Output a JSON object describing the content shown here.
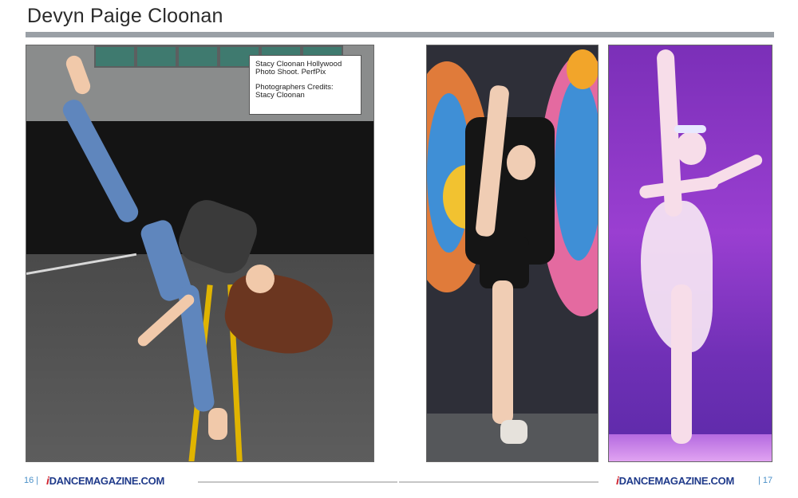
{
  "page": {
    "title": "Devyn Paige Cloonan"
  },
  "caption": {
    "line1": "Stacy Cloonan  Hollywood",
    "line2": "Photo Shoot.  PerfPix",
    "line3": "Photographers Credits:",
    "line4": "Stacy Cloonan"
  },
  "footer": {
    "left_page": "16 |",
    "right_page": "| 17",
    "brand_i": "i",
    "brand_name": "DANCEMAGAZINE.COM"
  },
  "photos": [
    {
      "subject": "street dance photo"
    },
    {
      "subject": "mural split photo"
    },
    {
      "subject": "stage ballet photo"
    }
  ],
  "colors": {
    "accent_rule": "#9aa0a6",
    "brand_blue": "#1f3a8a",
    "brand_red": "#d1242f",
    "page_number": "#4a90c8"
  }
}
